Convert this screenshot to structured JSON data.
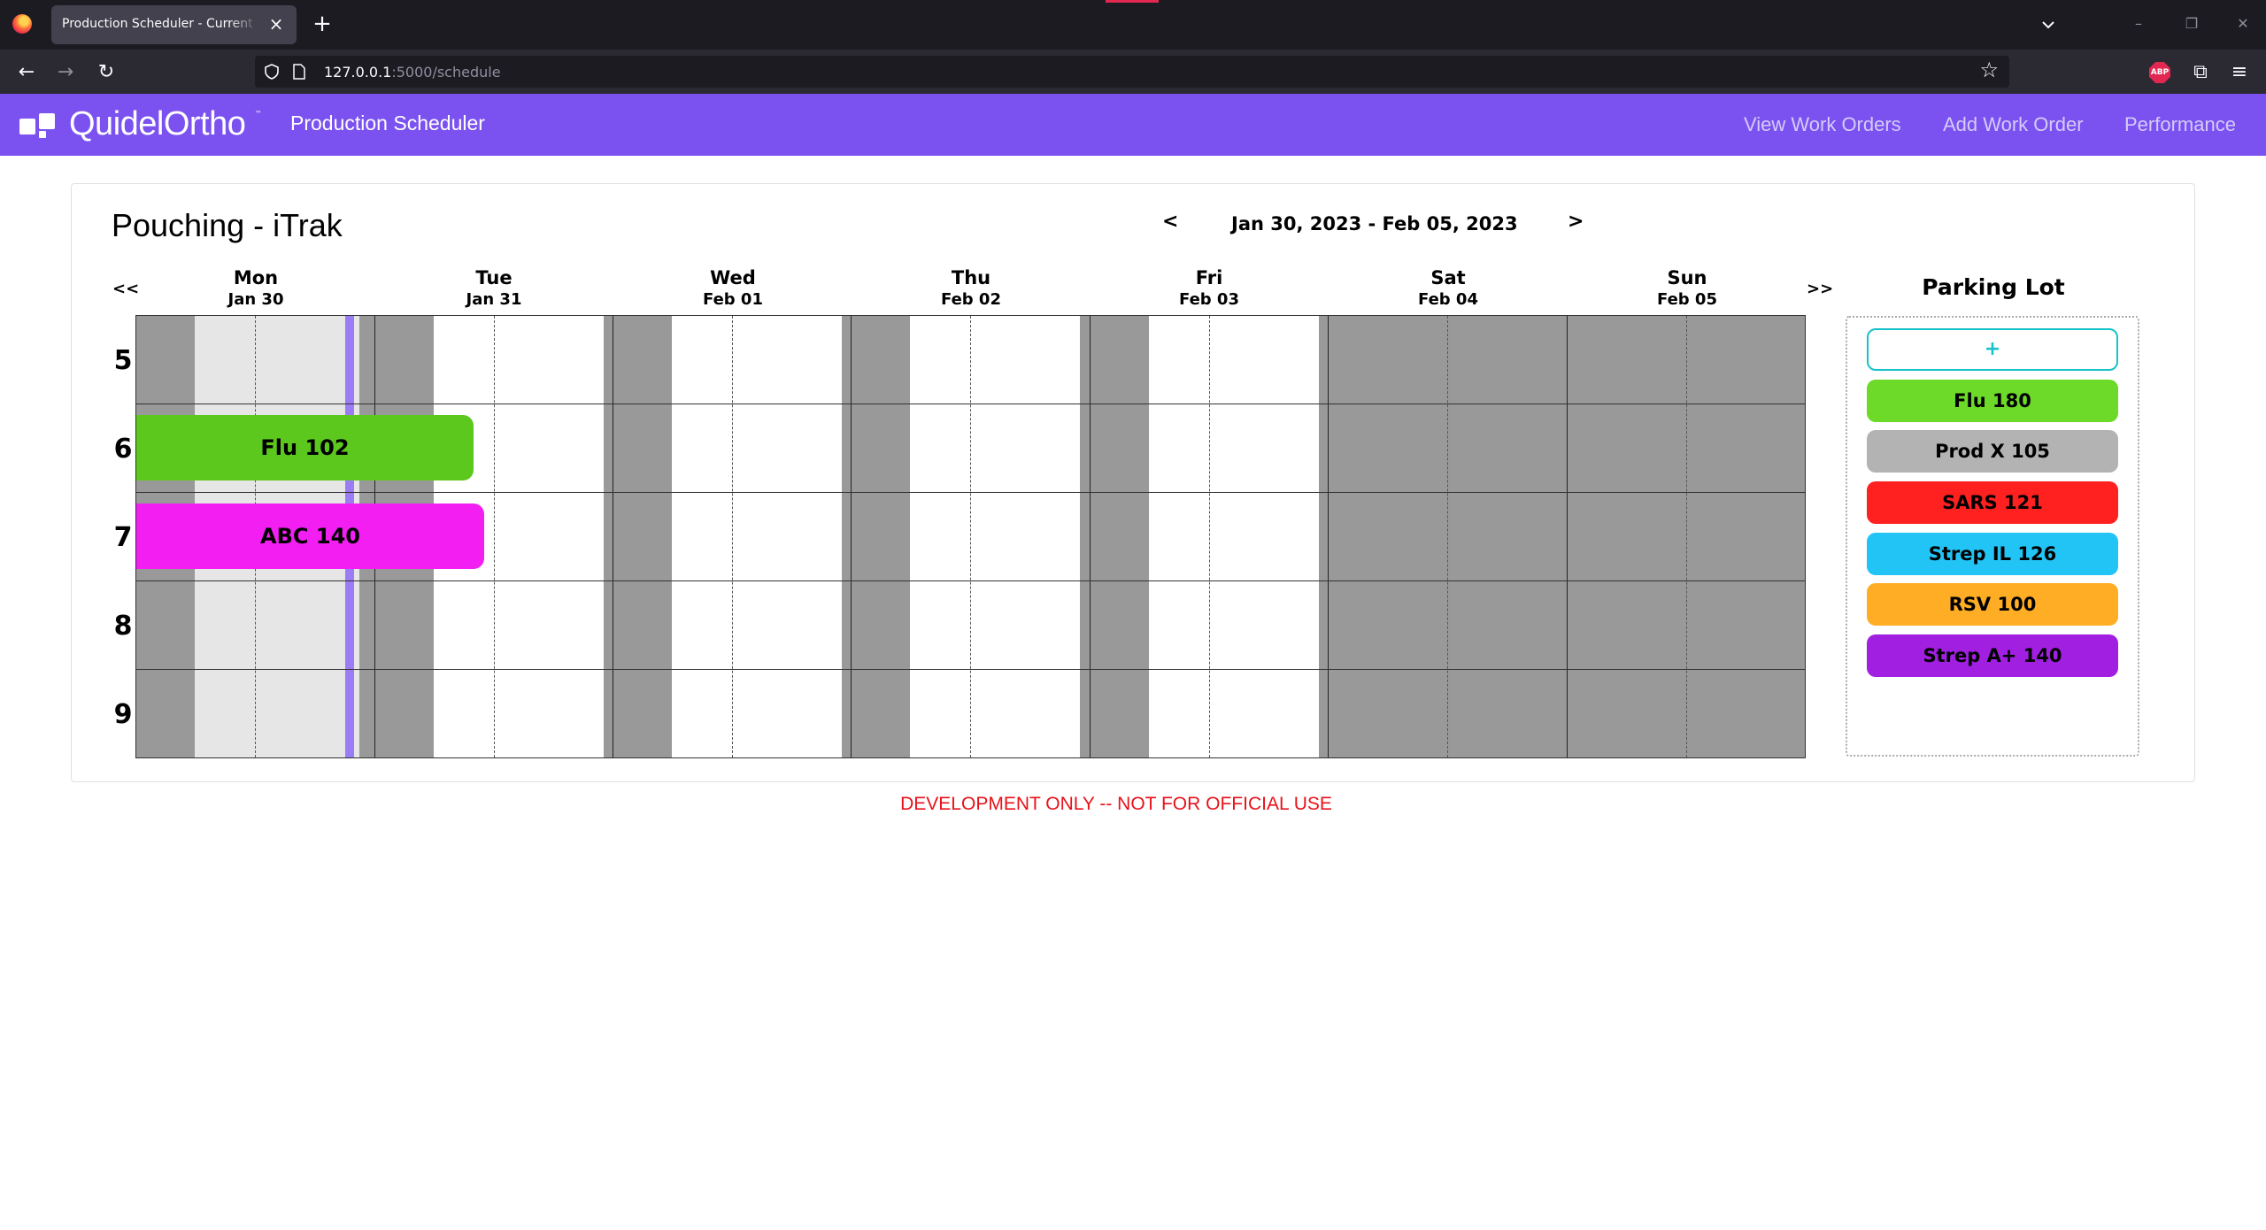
{
  "browser": {
    "tab_title": "Production Scheduler - Current Schedule",
    "tab_close": "×",
    "new_tab": "+",
    "url_host": "127.0.0.1",
    "url_path": ":5000/schedule",
    "back_icon": "←",
    "forward_icon": "→",
    "reload_icon": "↻",
    "bookmark_icon": "☆",
    "extensions_icon": "⧉",
    "menu_icon": "≡",
    "abp_label": "ABP",
    "minimize": "–",
    "restore": "❐",
    "close": "✕"
  },
  "header": {
    "brand": "QuidelOrtho",
    "brand_tm": "™",
    "app_title": "Production Scheduler",
    "links": [
      "View Work Orders",
      "Add Work Order",
      "Performance"
    ]
  },
  "schedule": {
    "title": "Pouching - iTrak",
    "prev_week": "<",
    "next_week": ">",
    "week_range": "Jan 30, 2023 - Feb 05, 2023",
    "jump_back": "<<",
    "jump_forward": ">>",
    "days": [
      {
        "name": "Mon",
        "date": "Jan 30"
      },
      {
        "name": "Tue",
        "date": "Jan 31"
      },
      {
        "name": "Wed",
        "date": "Feb 01"
      },
      {
        "name": "Thu",
        "date": "Feb 02"
      },
      {
        "name": "Fri",
        "date": "Feb 03"
      },
      {
        "name": "Sat",
        "date": "Feb 04"
      },
      {
        "name": "Sun",
        "date": "Feb 05"
      }
    ],
    "rows": [
      "5",
      "6",
      "7",
      "8",
      "9"
    ],
    "jobs": [
      {
        "label": "Flu 102",
        "color": "#5cc81e"
      },
      {
        "label": "ABC 140",
        "color": "#f21ef2"
      }
    ]
  },
  "parking_lot": {
    "title": "Parking Lot",
    "add_label": "+",
    "items": [
      {
        "label": "Flu 180",
        "color": "#6dd928"
      },
      {
        "label": "Prod X 105",
        "color": "#b3b3b3"
      },
      {
        "label": "SARS 121",
        "color": "#ff2020"
      },
      {
        "label": "Strep IL 126",
        "color": "#22c3f5"
      },
      {
        "label": "RSV 100",
        "color": "#ffad24"
      },
      {
        "label": "Strep A+ 140",
        "color": "#a01fe0"
      }
    ]
  },
  "footer": {
    "banner": "DEVELOPMENT ONLY -- NOT FOR OFFICIAL USE"
  }
}
